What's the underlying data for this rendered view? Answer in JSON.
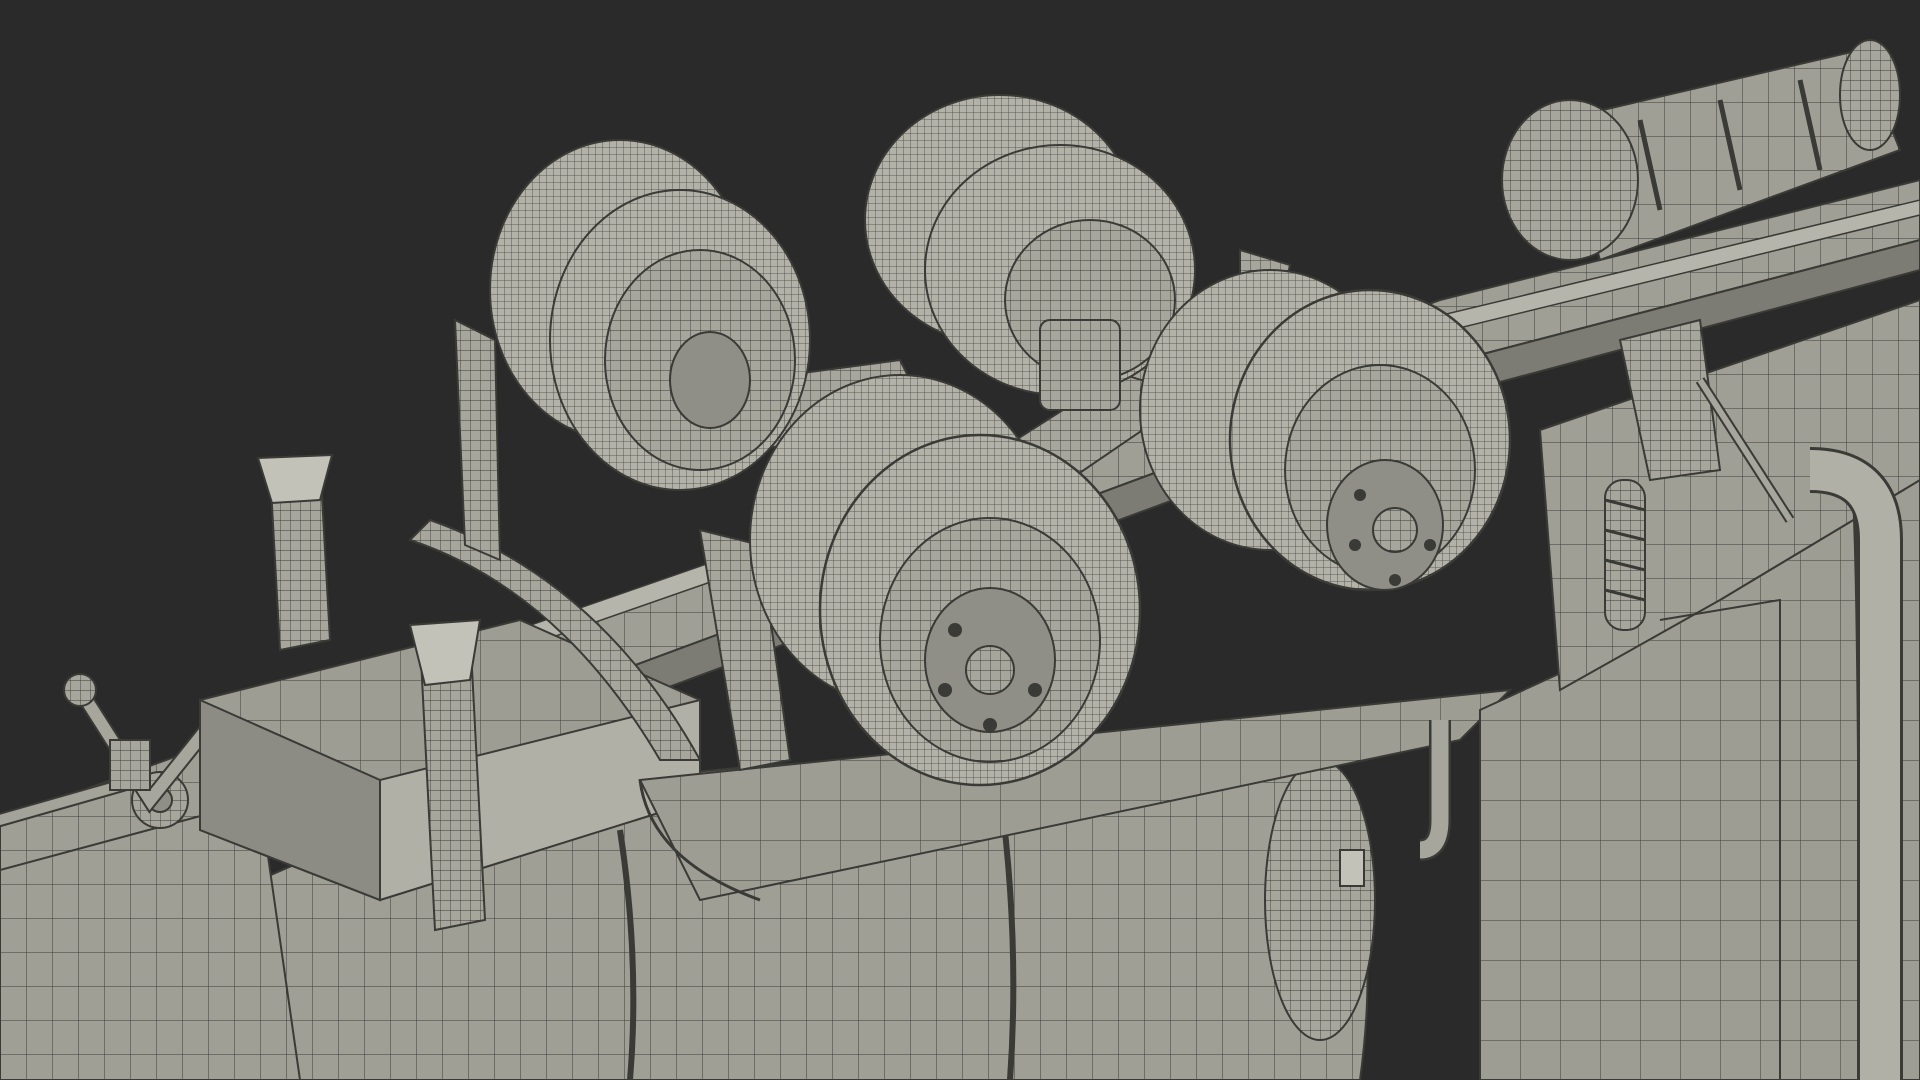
{
  "scene": {
    "subject": "truck-chassis-wireframe-render",
    "colors": {
      "background": "#2a2a2a",
      "surface": "#a3a39a",
      "surface_light": "#c2c2b8",
      "surface_dark": "#7c7c74",
      "wire": "#3a3a36",
      "hub": "#8f8f87"
    },
    "wheel_groups": [
      {
        "name": "rear-axle-left-dual-wheels",
        "tires_per_side": 2
      },
      {
        "name": "rear-axle-right-dual-wheels",
        "tires_per_side": 2
      },
      {
        "name": "front-axle-left-dual-wheels",
        "tires_per_side": 2
      },
      {
        "name": "front-axle-right-dual-wheels",
        "tires_per_side": 2
      }
    ]
  }
}
